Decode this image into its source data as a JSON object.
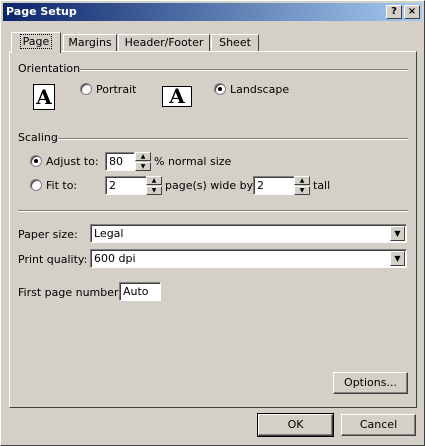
{
  "window": {
    "title": "Page Setup",
    "help_glyph": "?",
    "close_glyph": "×"
  },
  "tabs": [
    {
      "label": "Page"
    },
    {
      "label": "Margins"
    },
    {
      "label": "Header/Footer"
    },
    {
      "label": "Sheet"
    }
  ],
  "orientation": {
    "group_label": "Orientation",
    "portrait_label": "Portrait",
    "landscape_label": "Landscape",
    "icon_glyph": "A",
    "selected": "landscape"
  },
  "scaling": {
    "group_label": "Scaling",
    "adjust_label": "Adjust to:",
    "adjust_value": "80",
    "adjust_suffix": "% normal size",
    "fit_label": "Fit to:",
    "fit_wide_value": "2",
    "fit_wide_suffix": "page(s) wide by",
    "fit_tall_value": "2",
    "fit_tall_suffix": "tall",
    "selected": "adjust"
  },
  "paper": {
    "size_label": "Paper size:",
    "size_value": "Legal",
    "quality_label": "Print quality:",
    "quality_value": "600 dpi",
    "first_page_label": "First page number:",
    "first_page_value": "Auto"
  },
  "buttons": {
    "options": "Options...",
    "ok": "OK",
    "cancel": "Cancel"
  }
}
